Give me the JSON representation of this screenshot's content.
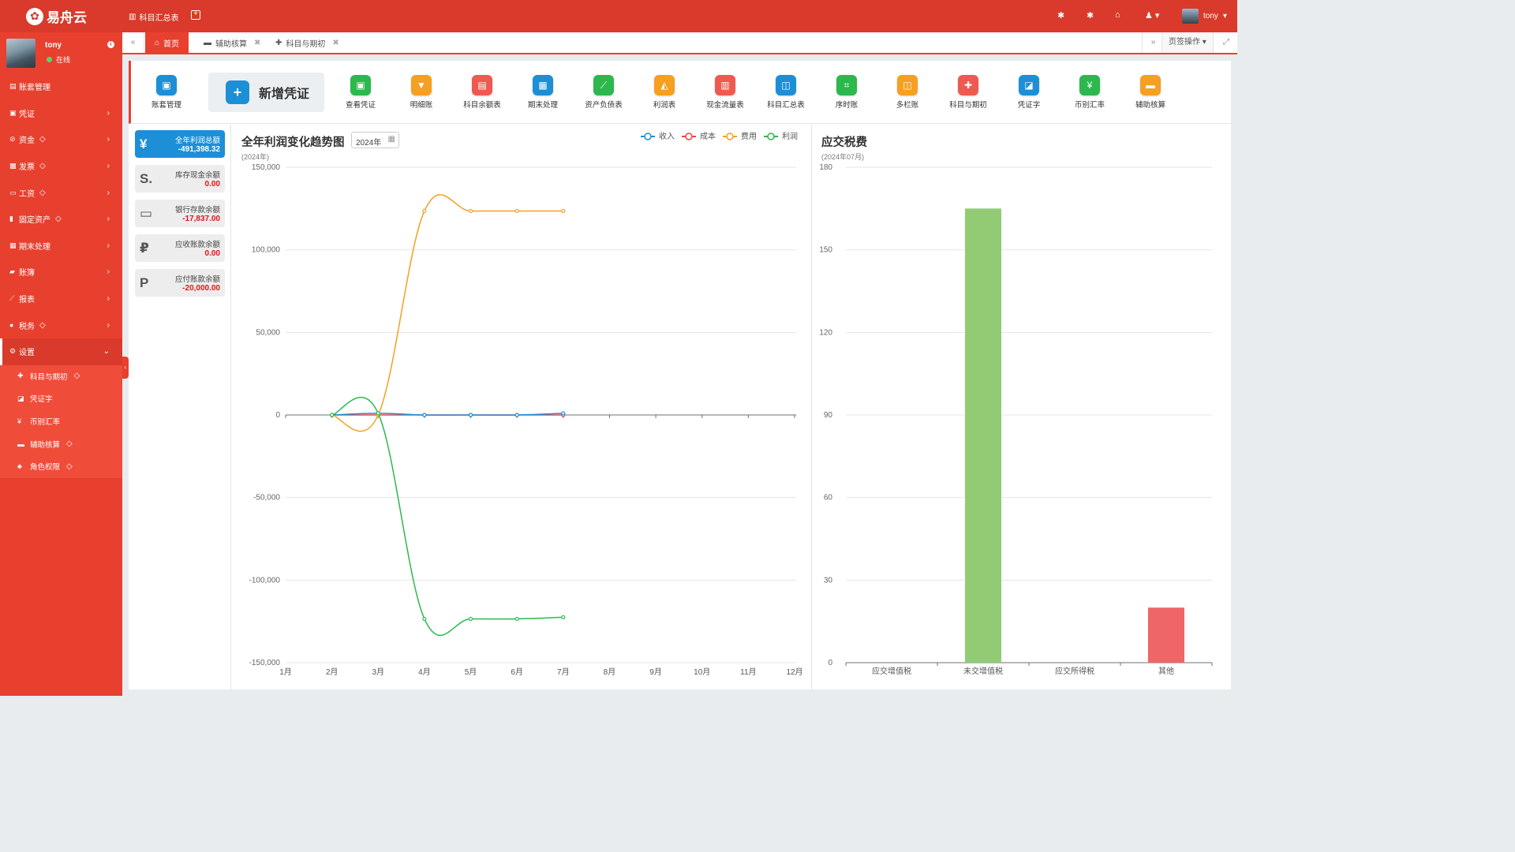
{
  "topbar": {
    "brand": "易舟云",
    "quick_link": "科目汇总表",
    "username": "tony"
  },
  "sidebar": {
    "user": {
      "name": "tony",
      "status": "在线"
    },
    "items": [
      {
        "label": "账套管理",
        "icon": "book-icon",
        "gem": false,
        "chevron": false
      },
      {
        "label": "凭证",
        "icon": "voucher-icon",
        "gem": false,
        "chevron": true
      },
      {
        "label": "资金",
        "icon": "money-icon",
        "gem": true,
        "chevron": true
      },
      {
        "label": "发票",
        "icon": "invoice-icon",
        "gem": true,
        "chevron": true
      },
      {
        "label": "工资",
        "icon": "card-icon",
        "gem": true,
        "chevron": true
      },
      {
        "label": "固定资产",
        "icon": "asset-icon",
        "gem": true,
        "chevron": true
      },
      {
        "label": "期末处理",
        "icon": "calendar-icon",
        "gem": false,
        "chevron": true
      },
      {
        "label": "账簿",
        "icon": "ledger-icon",
        "gem": false,
        "chevron": true
      },
      {
        "label": "报表",
        "icon": "chart-icon",
        "gem": false,
        "chevron": true
      },
      {
        "label": "税务",
        "icon": "tax-icon",
        "gem": true,
        "chevron": true
      },
      {
        "label": "设置",
        "icon": "gear-icon",
        "gem": false,
        "chevron": true,
        "active": true
      }
    ],
    "subitems": [
      {
        "label": "科目与期初",
        "icon": "puzzle-icon",
        "gem": true
      },
      {
        "label": "凭证字",
        "icon": "stamp-icon",
        "gem": false
      },
      {
        "label": "币别汇率",
        "icon": "yen-icon",
        "gem": false
      },
      {
        "label": "辅助核算",
        "icon": "folder-icon",
        "gem": true
      },
      {
        "label": "角色权限",
        "icon": "users-icon",
        "gem": true
      }
    ]
  },
  "tabs": {
    "items": [
      {
        "label": "首页",
        "active": true
      },
      {
        "label": "辅助核算",
        "active": false
      },
      {
        "label": "科目与期初",
        "active": false
      }
    ],
    "page_ops": "页签操作"
  },
  "quickbar": {
    "big_button": "新增凭证",
    "items": [
      {
        "label": "账套管理",
        "color": "#1d8fd6",
        "icon": "box-icon"
      },
      {
        "label": "查看凭证",
        "color": "#2db84d",
        "icon": "voucher-icon"
      },
      {
        "label": "明细账",
        "color": "#f5a020",
        "icon": "bookmark-icon"
      },
      {
        "label": "科目余额表",
        "color": "#ee5a4f",
        "icon": "book-icon"
      },
      {
        "label": "期末处理",
        "color": "#1d8fd6",
        "icon": "calendar-icon"
      },
      {
        "label": "资产负债表",
        "color": "#2db84d",
        "icon": "line-chart-icon"
      },
      {
        "label": "利润表",
        "color": "#f5a020",
        "icon": "area-chart-icon"
      },
      {
        "label": "现金流量表",
        "color": "#ee5a4f",
        "icon": "bar-chart-icon"
      },
      {
        "label": "科目汇总表",
        "color": "#1d8fd6",
        "icon": "columns-icon"
      },
      {
        "label": "序时账",
        "color": "#2db84d",
        "icon": "crop-icon"
      },
      {
        "label": "多栏账",
        "color": "#f5a020",
        "icon": "columns-icon"
      },
      {
        "label": "科目与期初",
        "color": "#ee5a4f",
        "icon": "puzzle-icon"
      },
      {
        "label": "凭证字",
        "color": "#1d8fd6",
        "icon": "stamp-icon"
      },
      {
        "label": "币别汇率",
        "color": "#2db84d",
        "icon": "yen-icon"
      },
      {
        "label": "辅助核算",
        "color": "#f5a020",
        "icon": "folder-icon"
      }
    ]
  },
  "cards": [
    {
      "label": "全年利润总额",
      "value": "-491,398.32",
      "icon": "yen-icon",
      "highlight": true
    },
    {
      "label": "库存现金余额",
      "value": "0.00",
      "icon": "cash-icon",
      "highlight": false
    },
    {
      "label": "银行存款余额",
      "value": "-17,837.00",
      "icon": "credit-card-icon",
      "highlight": false
    },
    {
      "label": "应收账款余额",
      "value": "0.00",
      "icon": "ruble-icon",
      "highlight": false
    },
    {
      "label": "应付账款余额",
      "value": "-20,000.00",
      "icon": "paypal-icon",
      "highlight": false
    }
  ],
  "profit_chart": {
    "title": "全年利润变化趋势图",
    "subtitle": "(2024年)",
    "year_value": "2024年"
  },
  "tax_chart": {
    "title": "应交税费",
    "subtitle": "(2024年07月)"
  },
  "chart_data": [
    {
      "type": "line",
      "title": "全年利润变化趋势图",
      "subtitle": "(2024年)",
      "x": [
        "1月",
        "2月",
        "3月",
        "4月",
        "5月",
        "6月",
        "7月",
        "8月",
        "9月",
        "10月",
        "11月",
        "12月"
      ],
      "ylim": [
        -150000,
        150000
      ],
      "yticks": [
        -150000,
        -100000,
        -50000,
        0,
        50000,
        100000,
        150000
      ],
      "ytick_labels": [
        "-150,000",
        "-100,000",
        "-50,000",
        "0",
        "50,000",
        "100,000",
        "150,000"
      ],
      "grid": true,
      "legend_position": "top-right",
      "series": [
        {
          "name": "收入",
          "color": "#1d8fd6",
          "values": [
            null,
            0,
            1000,
            0,
            0,
            0,
            1000,
            null,
            null,
            null,
            null,
            null
          ]
        },
        {
          "name": "成本",
          "color": "#ee4444",
          "values": [
            null,
            0,
            0,
            0,
            0,
            0,
            0,
            null,
            null,
            null,
            null,
            null
          ]
        },
        {
          "name": "费用",
          "color": "#f5a020",
          "values": [
            null,
            0,
            0,
            123500,
            123500,
            123500,
            123500,
            null,
            null,
            null,
            null,
            null
          ]
        },
        {
          "name": "利润",
          "color": "#2db84d",
          "values": [
            null,
            0,
            1000,
            -123500,
            -123500,
            -123500,
            -122500,
            null,
            null,
            null,
            null,
            null
          ]
        }
      ]
    },
    {
      "type": "bar",
      "title": "应交税费",
      "subtitle": "(2024年07月)",
      "categories": [
        "应交增值税",
        "未交增值税",
        "应交所得税",
        "其他"
      ],
      "values": [
        0,
        165,
        0,
        20
      ],
      "colors": [
        "#91cc75",
        "#91cc75",
        "#91cc75",
        "#ee6666"
      ],
      "ylim": [
        0,
        180
      ],
      "yticks": [
        0,
        30,
        60,
        90,
        120,
        150,
        180
      ],
      "grid": true
    }
  ]
}
